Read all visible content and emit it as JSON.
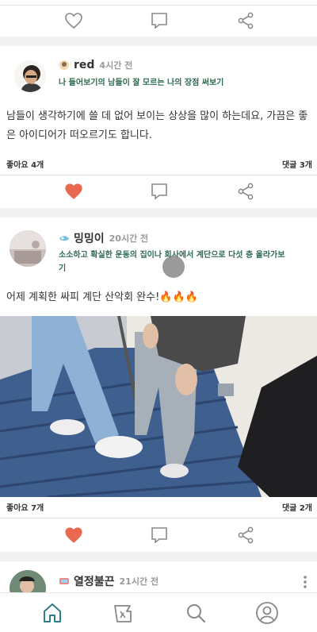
{
  "colors": {
    "accent": "#e8694f",
    "teal": "#2f7f86",
    "topic": "#2e6b4f",
    "divider": "#f1f1f1"
  },
  "posts": [
    {
      "username": "red",
      "time": "4시간 전",
      "topic": "나 들어보기의 남들이 잘 모르는 나의 장점 써보기",
      "body": "남들이 생각하기에 쓸 데 없어 보이는 상상을 많이 하는데요, 가끔은 좋은 아이디어가 떠오르기도 합니다.",
      "likes": "좋아요 4개",
      "comments": "댓글 3개",
      "liked": true
    },
    {
      "username": "밍밍이",
      "time": "20시간 전",
      "topic": "소소하고 확실한 운동의 집이나 회사에서 계단으로 다섯 층 올라가보기",
      "body": "어제 계획한 싸피 계단 산악회 완수!🔥🔥🔥",
      "likes": "좋아요 7개",
      "comments": "댓글 2개",
      "liked": true
    },
    {
      "username": "열정불끈",
      "time": "21시간 전"
    }
  ],
  "icons": {
    "like": "heart-icon",
    "comment": "comment-icon",
    "share": "share-icon",
    "home": "home-icon",
    "challenge": "flag-board-icon",
    "search": "search-icon",
    "profile": "profile-icon"
  }
}
